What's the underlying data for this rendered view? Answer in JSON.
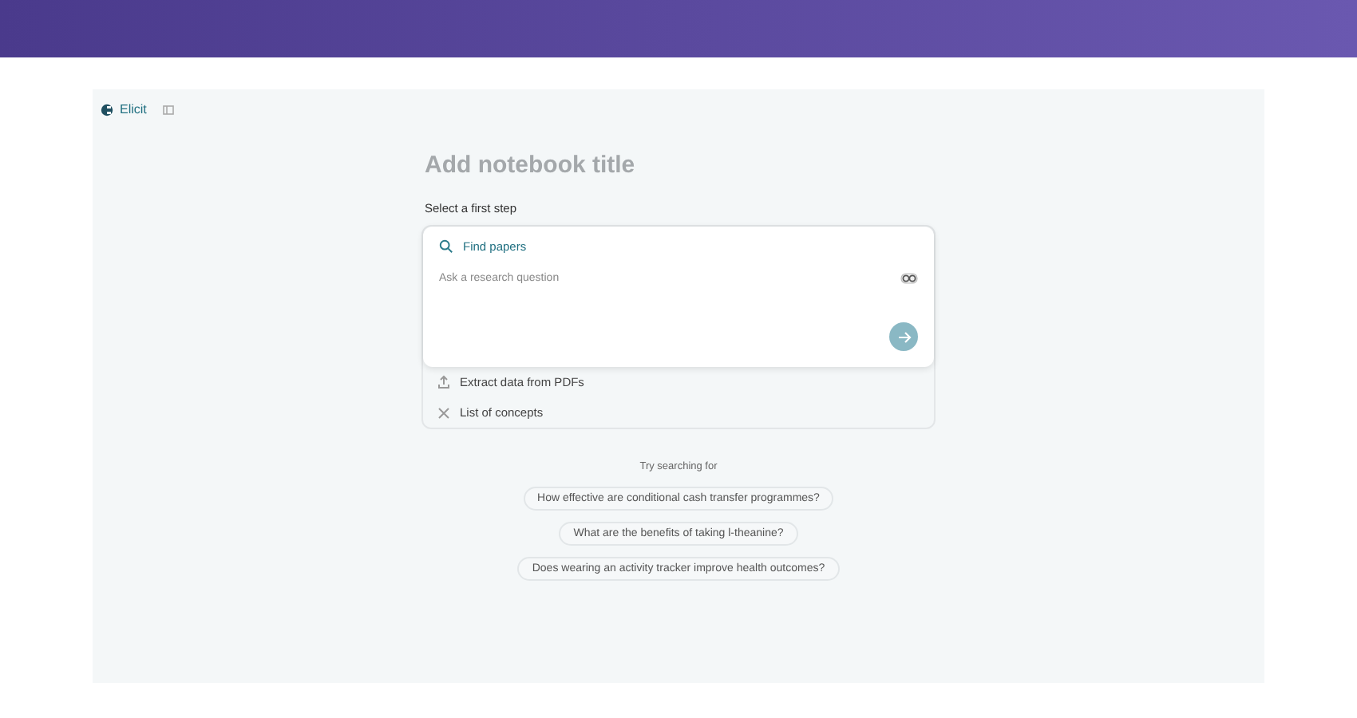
{
  "brand": {
    "name": "Elicit"
  },
  "notebook": {
    "title_placeholder": "Add notebook title"
  },
  "step_prompt": "Select a first step",
  "steps": [
    {
      "label": "Find papers",
      "kind": "search",
      "selected": true,
      "placeholder": "Ask a research question"
    },
    {
      "label": "Extract data from PDFs",
      "kind": "extract",
      "selected": false
    },
    {
      "label": "List of concepts",
      "kind": "concepts",
      "selected": false
    }
  ],
  "suggestions": {
    "heading": "Try searching for",
    "items": [
      "How effective are conditional cash transfer programmes?",
      "What are the benefits of taking l-theanine?",
      "Does wearing an activity tracker improve health outcomes?"
    ]
  }
}
